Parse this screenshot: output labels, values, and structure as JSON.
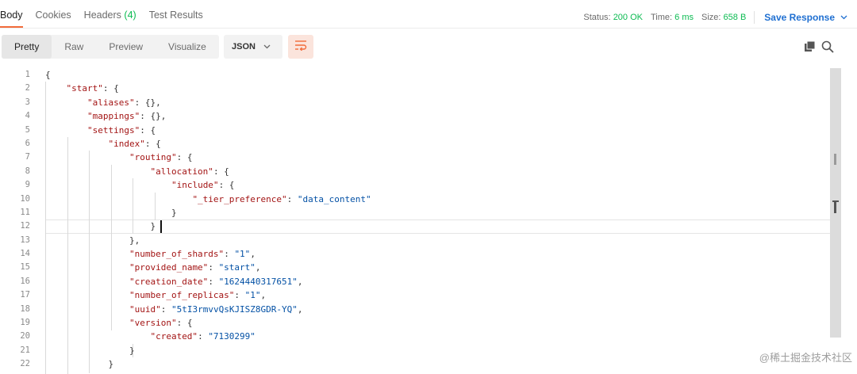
{
  "tabs": [
    {
      "label": "Body",
      "count": "",
      "active": true
    },
    {
      "label": "Cookies",
      "count": "",
      "active": false
    },
    {
      "label": "Headers",
      "count": "(4)",
      "active": false
    },
    {
      "label": "Test Results",
      "count": "",
      "active": false
    }
  ],
  "status": {
    "status_label": "Status:",
    "status_value": "200 OK",
    "time_label": "Time:",
    "time_value": "6 ms",
    "size_label": "Size:",
    "size_value": "658 B",
    "save_label": "Save Response"
  },
  "view_modes": [
    {
      "label": "Pretty",
      "active": true
    },
    {
      "label": "Raw",
      "active": false
    },
    {
      "label": "Preview",
      "active": false
    },
    {
      "label": "Visualize",
      "active": false
    }
  ],
  "format": {
    "selected": "JSON",
    "icon": "chevron-down-icon"
  },
  "icons": {
    "wrap": "wrap-lines-icon",
    "copy": "copy-icon",
    "search": "search-icon"
  },
  "colors": {
    "accent": "#f26b3a",
    "success": "#0cbb52",
    "link": "#1f6fd1",
    "key": "#a31515",
    "string": "#0451a5"
  },
  "code_lines": [
    {
      "n": "1",
      "tokens": [
        [
          "p",
          "{"
        ]
      ]
    },
    {
      "n": "2",
      "tokens": [
        [
          "p",
          "    "
        ],
        [
          "k",
          "\"start\""
        ],
        [
          "p",
          ": {"
        ]
      ]
    },
    {
      "n": "3",
      "tokens": [
        [
          "p",
          "        "
        ],
        [
          "k",
          "\"aliases\""
        ],
        [
          "p",
          ": {},"
        ]
      ]
    },
    {
      "n": "4",
      "tokens": [
        [
          "p",
          "        "
        ],
        [
          "k",
          "\"mappings\""
        ],
        [
          "p",
          ": {},"
        ]
      ]
    },
    {
      "n": "5",
      "tokens": [
        [
          "p",
          "        "
        ],
        [
          "k",
          "\"settings\""
        ],
        [
          "p",
          ": {"
        ]
      ]
    },
    {
      "n": "6",
      "tokens": [
        [
          "p",
          "            "
        ],
        [
          "k",
          "\"index\""
        ],
        [
          "p",
          ": {"
        ]
      ]
    },
    {
      "n": "7",
      "tokens": [
        [
          "p",
          "                "
        ],
        [
          "k",
          "\"routing\""
        ],
        [
          "p",
          ": {"
        ]
      ]
    },
    {
      "n": "8",
      "tokens": [
        [
          "p",
          "                    "
        ],
        [
          "k",
          "\"allocation\""
        ],
        [
          "p",
          ": {"
        ]
      ]
    },
    {
      "n": "9",
      "tokens": [
        [
          "p",
          "                        "
        ],
        [
          "k",
          "\"include\""
        ],
        [
          "p",
          ": {"
        ]
      ]
    },
    {
      "n": "10",
      "tokens": [
        [
          "p",
          "                            "
        ],
        [
          "k",
          "\"_tier_preference\""
        ],
        [
          "p",
          ": "
        ],
        [
          "s",
          "\"data_content\""
        ]
      ]
    },
    {
      "n": "11",
      "tokens": [
        [
          "p",
          "                        }"
        ]
      ]
    },
    {
      "n": "12",
      "tokens": [
        [
          "p",
          "                    }"
        ]
      ]
    },
    {
      "n": "13",
      "tokens": [
        [
          "p",
          "                },"
        ]
      ]
    },
    {
      "n": "14",
      "tokens": [
        [
          "p",
          "                "
        ],
        [
          "k",
          "\"number_of_shards\""
        ],
        [
          "p",
          ": "
        ],
        [
          "s",
          "\"1\""
        ],
        [
          "p",
          ","
        ]
      ]
    },
    {
      "n": "15",
      "tokens": [
        [
          "p",
          "                "
        ],
        [
          "k",
          "\"provided_name\""
        ],
        [
          "p",
          ": "
        ],
        [
          "s",
          "\"start\""
        ],
        [
          "p",
          ","
        ]
      ]
    },
    {
      "n": "16",
      "tokens": [
        [
          "p",
          "                "
        ],
        [
          "k",
          "\"creation_date\""
        ],
        [
          "p",
          ": "
        ],
        [
          "s",
          "\"1624440317651\""
        ],
        [
          "p",
          ","
        ]
      ]
    },
    {
      "n": "17",
      "tokens": [
        [
          "p",
          "                "
        ],
        [
          "k",
          "\"number_of_replicas\""
        ],
        [
          "p",
          ": "
        ],
        [
          "s",
          "\"1\""
        ],
        [
          "p",
          ","
        ]
      ]
    },
    {
      "n": "18",
      "tokens": [
        [
          "p",
          "                "
        ],
        [
          "k",
          "\"uuid\""
        ],
        [
          "p",
          ": "
        ],
        [
          "s",
          "\"5tI3rmvvQsKJISZ8GDR-YQ\""
        ],
        [
          "p",
          ","
        ]
      ]
    },
    {
      "n": "19",
      "tokens": [
        [
          "p",
          "                "
        ],
        [
          "k",
          "\"version\""
        ],
        [
          "p",
          ": {"
        ]
      ]
    },
    {
      "n": "20",
      "tokens": [
        [
          "p",
          "                    "
        ],
        [
          "k",
          "\"created\""
        ],
        [
          "p",
          ": "
        ],
        [
          "s",
          "\"7130299\""
        ]
      ]
    },
    {
      "n": "21",
      "tokens": [
        [
          "p",
          "                }"
        ]
      ]
    },
    {
      "n": "22",
      "tokens": [
        [
          "p",
          "            }"
        ]
      ]
    }
  ],
  "watermark": "@稀土掘金技术社区"
}
